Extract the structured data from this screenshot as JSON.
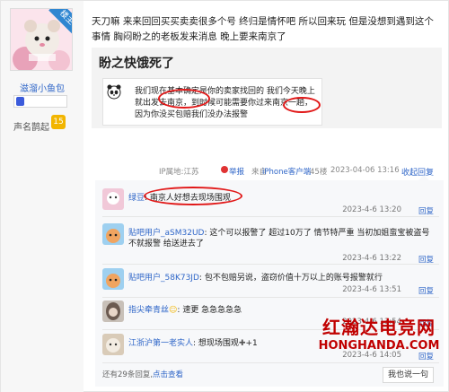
{
  "author": {
    "badge": "楼主",
    "username": "滋溜小鱼包",
    "fame_label": "声名鹊起",
    "fame_level": "15"
  },
  "post": {
    "text": "天刀嘛 来来回回买买卖卖很多个号 终归是情怀吧 所以回来玩 但是没想到遇到这个事情 胸闷盼之的老板发来消息 晚上要来南京了",
    "quote_title": "盼之快饿死了",
    "chat_text": "我们现在基本确定是你的卖家找回的 我们今天晚上就出发去南京，到时候可能需要你过来南京一趟，因为你没买包赔我们没办法报警"
  },
  "meta": {
    "ip": "IP属地:江苏",
    "report": "举报",
    "from_prefix": "来自",
    "from_link": "iPhone客户端",
    "floor": "45楼",
    "time": "2023-04-06 13:16",
    "collapse": "收起回复"
  },
  "replies": [
    {
      "name": "绿豆",
      "text": "南京人好想去现场围观",
      "time": "2023-4-6 13:20",
      "action": "回复"
    },
    {
      "name": "贴吧用户_aSM32UD",
      "text": "这个可以报警了 超过10万了 情节特严重 当初加姐蛮宝被盗号不就报警 给送进去了",
      "time": "2023-4-6 13:22",
      "action": "回复"
    },
    {
      "name": "贴吧用户_58K73JD",
      "text": "包不包赔另说，盗窃价值十万以上的账号报警就行",
      "time": "2023-4-6 13:51",
      "action": "回复"
    },
    {
      "name": "指尖牵青丝",
      "text": "速更 急急急急急",
      "time": "2023-4-6 13:54",
      "action": "回复"
    },
    {
      "name": "江浙沪第一老实人",
      "text": "想现场围观",
      "suffix": "+1",
      "time": "2023-4-6 14:05",
      "action": "回复"
    }
  ],
  "footer": {
    "more_prefix": "还有29条回复,",
    "more_link": "点击查看",
    "say_button": "我也说一句"
  },
  "watermark": {
    "line1": "红瀚达电竞网",
    "line2": "HONGHANDA.COM"
  }
}
